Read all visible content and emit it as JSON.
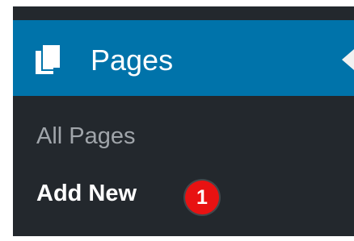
{
  "menu": {
    "title": "Pages",
    "icon": "pages-icon",
    "collapse_icon": "collapse-arrow-icon",
    "submenu": [
      {
        "label": "All Pages",
        "state": "inactive"
      },
      {
        "label": "Add New",
        "state": "active"
      }
    ]
  },
  "annotation": {
    "step_number": "1"
  },
  "colors": {
    "sidebar_background": "#23282d",
    "header_background": "#0073aa",
    "inactive_text": "#a0a5aa",
    "active_text": "#ffffff",
    "badge_background": "#e81212"
  }
}
